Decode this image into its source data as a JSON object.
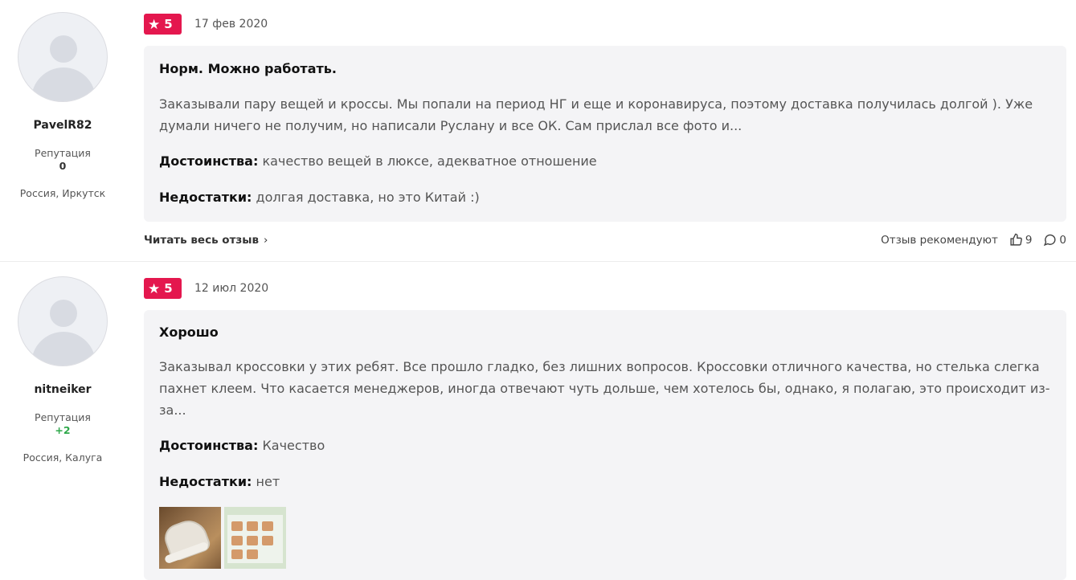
{
  "reviews": [
    {
      "user": {
        "name": "PavelR82",
        "reputation_label": "Репутация",
        "reputation_value": "0",
        "location": "Россия, Иркутск"
      },
      "rating": "5",
      "date": "17 фев 2020",
      "title": "Норм. Можно работать.",
      "text": "Заказывали пару вещей и кроссы. Мы попали на период НГ и еще и коронавируса, поэтому доставка получилась долгой ). Уже думали ничего не получим, но написали Руслану и все ОК. Сам прислал все фото и...",
      "pros_label": "Достоинства:",
      "pros": "качество вещей в люксе, адекватное отношение",
      "cons_label": "Недостатки:",
      "cons": "долгая доставка, но это Китай :)",
      "read_more": "Читать весь отзыв",
      "recommend_label": "Отзыв рекомендуют",
      "likes": "9",
      "comments": "0"
    },
    {
      "user": {
        "name": "nitneiker",
        "reputation_label": "Репутация",
        "reputation_value": "+2",
        "location": "Россия, Калуга"
      },
      "rating": "5",
      "date": "12 июл 2020",
      "title": "Хорошо",
      "text": "Заказывал кроссовки у этих ребят. Все прошло гладко, без лишних вопросов. Кроссовки отличного качества, но стелька слегка пахнет клеем. Что касается менеджеров, иногда отвечают чуть дольше, чем хотелось бы, однако, я полагаю, это происходит из-за...",
      "pros_label": "Достоинства:",
      "pros": "Качество",
      "cons_label": "Недостатки:",
      "cons": "нет"
    }
  ],
  "colors": {
    "badge": "#e4174e",
    "card_bg": "#f4f4f6",
    "positive": "#2ea84a"
  }
}
